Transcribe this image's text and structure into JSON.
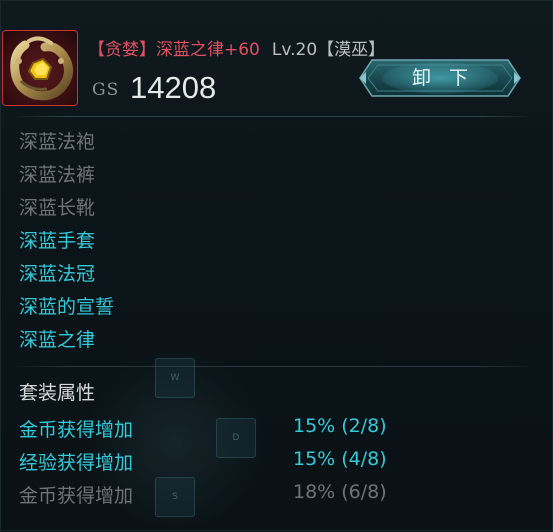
{
  "item": {
    "title": "【贪婪】深蓝之律+60",
    "level_class": "Lv.20【漠巫】",
    "gs_label": "GS",
    "gs_value": "14208",
    "icon": "bracelet-icon",
    "rarity_color": "#cc3333"
  },
  "actions": {
    "unequip_label": "卸下"
  },
  "set_pieces": [
    {
      "name": "深蓝法袍",
      "equipped": false
    },
    {
      "name": "深蓝法裤",
      "equipped": false
    },
    {
      "name": "深蓝长靴",
      "equipped": false
    },
    {
      "name": "深蓝手套",
      "equipped": true
    },
    {
      "name": "深蓝法冠",
      "equipped": true
    },
    {
      "name": "深蓝的宣誓",
      "equipped": true
    },
    {
      "name": "深蓝之律",
      "equipped": true
    }
  ],
  "set_attributes": {
    "title": "套装属性",
    "rows": [
      {
        "name": "金币获得增加",
        "value": "15% (2/8)",
        "active": true
      },
      {
        "name": "经验获得增加",
        "value": "15% (4/8)",
        "active": true
      },
      {
        "name": "金币获得增加",
        "value": "18% (6/8)",
        "active": false
      }
    ]
  },
  "overlay_keys": {
    "up": "W",
    "right": "D",
    "down": "S"
  },
  "colors": {
    "active_text": "#36c9d8",
    "inactive_text": "#6c7477",
    "title_red": "#e05060",
    "background": "#0c1519"
  }
}
